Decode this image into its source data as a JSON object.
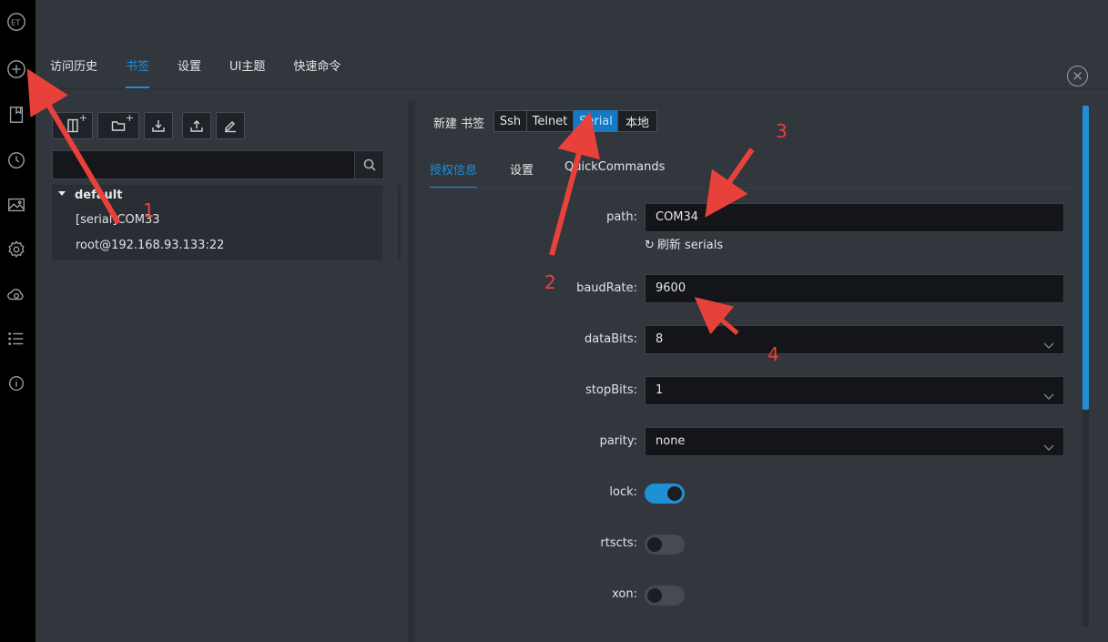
{
  "rail": {
    "icons": [
      "logo-icon",
      "plus-circle-icon",
      "bookmark-icon",
      "clock-icon",
      "image-icon",
      "gear-icon",
      "cloud-icon",
      "list-icon",
      "info-icon"
    ],
    "logo_text": "ET"
  },
  "tabs": [
    {
      "label": "访问历史"
    },
    {
      "label": "书签"
    },
    {
      "label": "设置"
    },
    {
      "label": "UI主题"
    },
    {
      "label": "快速命令"
    }
  ],
  "active_tab": "书签",
  "left": {
    "search": {
      "value": "",
      "placeholder": ""
    },
    "group": {
      "name": "default"
    },
    "items": [
      {
        "label": "[serial]COM33"
      },
      {
        "label": "root@192.168.93.133:22"
      }
    ]
  },
  "right": {
    "new_bookmark_label": "新建 书签",
    "types": [
      {
        "label": "Ssh"
      },
      {
        "label": "Telnet"
      },
      {
        "label": "Serial"
      },
      {
        "label": "本地"
      }
    ],
    "active_type": "Serial",
    "subtabs": [
      {
        "label": "授权信息"
      },
      {
        "label": "设置"
      },
      {
        "label": "QuickCommands"
      }
    ],
    "fields": {
      "path": {
        "label": "path:",
        "value": "COM34"
      },
      "refresh_label": "刷新 serials",
      "baudRate": {
        "label": "baudRate:",
        "value": "9600"
      },
      "dataBits": {
        "label": "dataBits:",
        "value": "8"
      },
      "stopBits": {
        "label": "stopBits:",
        "value": "1"
      },
      "parity": {
        "label": "parity:",
        "value": "none"
      },
      "lock": {
        "label": "lock:",
        "on": true
      },
      "rtscts": {
        "label": "rtscts:",
        "on": false
      },
      "xon": {
        "label": "xon:",
        "on": false
      }
    }
  },
  "annotations": [
    "1",
    "2",
    "3",
    "4"
  ],
  "colors": {
    "accent": "#1e90d6",
    "annotation": "#e8413b",
    "background": "#32363d"
  }
}
